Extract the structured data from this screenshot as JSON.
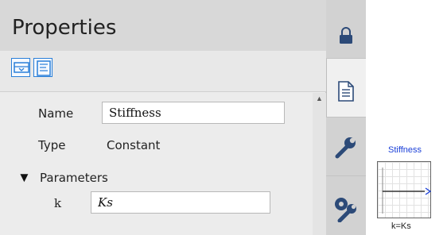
{
  "panel": {
    "title": "Properties"
  },
  "toolbar": {
    "buttons": [
      {
        "icon": "show-component-icon"
      },
      {
        "icon": "text-view-icon"
      }
    ]
  },
  "properties": {
    "name": {
      "label": "Name",
      "value": "Stiffness"
    },
    "type": {
      "label": "Type",
      "value": "Constant"
    },
    "parameters": {
      "label": "Parameters",
      "items": [
        {
          "name": "k",
          "value": "Ks"
        }
      ]
    }
  },
  "tabs": [
    {
      "icon": "lock-icon",
      "active": false
    },
    {
      "icon": "document-icon",
      "active": true
    },
    {
      "icon": "wrench-icon",
      "active": false
    },
    {
      "icon": "gear-wrench-icon",
      "active": false
    }
  ],
  "block": {
    "name": "Stiffness",
    "parameter_label": "k=Ks"
  },
  "colors": {
    "accent": "#2a7fd8",
    "block_name": "#1a3fd8"
  }
}
